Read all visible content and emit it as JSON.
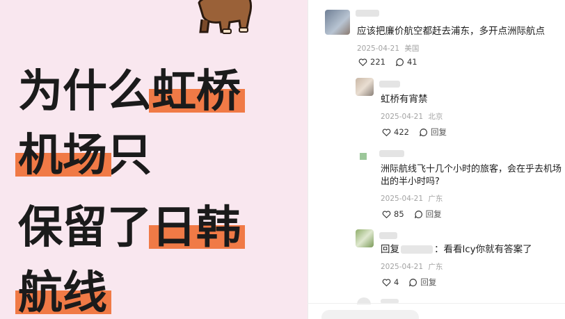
{
  "poster": {
    "line1_plain": "为什么",
    "line1_highlight": "虹桥",
    "line2_highlight": "机场",
    "line2_plain": "只",
    "line3_plain": "保留了",
    "line3_highlight": "日韩",
    "line4_highlight": "航线",
    "highlight_color": "#f07a46",
    "background_color": "#f9e7ef"
  },
  "comments": [
    {
      "text": "应该把廉价航空都赶去浦东，多开点洲际航点",
      "date": "2025-04-21",
      "location": "美国",
      "likes": "221",
      "replies": "41"
    },
    {
      "text": "虹桥有宵禁",
      "date": "2025-04-21",
      "location": "北京",
      "likes": "422",
      "reply_label": "回复"
    },
    {
      "text_line1": "洲际航线飞十几个小时的旅客，会在乎去机场",
      "text_line2": "出的半小时吗?",
      "date": "2025-04-21",
      "location": "广东",
      "likes": "85",
      "reply_label": "回复"
    },
    {
      "text_prefix": "回复",
      "text_suffix": "：看看lcy你就有答案了",
      "date": "2025-04-21",
      "location": "广东",
      "likes": "4",
      "reply_label": "回复"
    }
  ],
  "icons": {
    "like": "heart-icon",
    "comment": "comment-bubble-icon"
  }
}
